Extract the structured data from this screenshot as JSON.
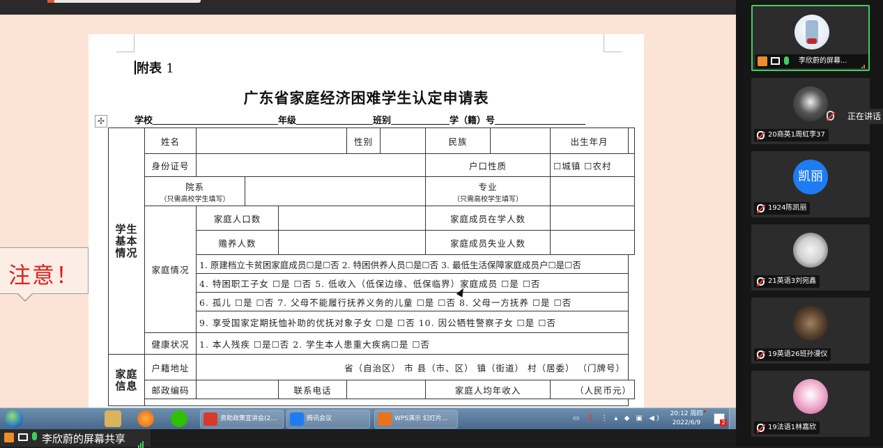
{
  "document": {
    "appendix_label": "附表",
    "appendix_num": "1",
    "title": "广东省家庭经济困难学生认定申请表",
    "header_school": "学校",
    "header_grade": "年级",
    "header_class": "班别",
    "header_id": "学（籍）号",
    "section_basic": "学生基本情况",
    "section_family": "家庭信息",
    "row_name": "姓名",
    "row_gender": "性别",
    "row_ethnicity": "民族",
    "row_birth": "出生年月",
    "row_idcard": "身份证号",
    "row_hukou": "户口性质",
    "hukou_options": "☐城镇    ☐农村",
    "row_faculty": "院系",
    "row_faculty_note": "（只需高校学生填写）",
    "row_major": "专业",
    "row_major_note": "（只需高校学生填写）",
    "row_family_situation": "家庭情况",
    "row_household_size": "家庭人口数",
    "row_studying_members": "家庭成员在学人数",
    "row_dependents": "赡养人数",
    "row_unemployed_members": "家庭成员失业人数",
    "fs_line1": "1. 原建档立卡贫困家庭成员☐是☐否 2. 特困供养人员☐是☐否 3. 最低生活保障家庭成员户☐是☐否",
    "fs_line2": "4. 特困职工子女  ☐是  ☐否     5. 低收入（低保边缘、低保临界）家庭成员  ☐是  ☐否",
    "fs_line3": "6. 孤儿  ☐是  ☐否  7. 父母不能履行抚养义务的儿童  ☐是  ☐否   8. 父母一方抚养  ☐是  ☐否",
    "fs_line4": "9. 享受国家定期抚恤补助的优抚对象子女  ☐是  ☐否     10. 因公牺牲警察子女  ☐是   ☐否",
    "row_health": "健康状况",
    "health_options": "1. 本人残疾  ☐是☐否        2. 学生本人患重大疾病☐是   ☐否",
    "row_address": "户籍地址",
    "address_template": "省（自治区）    市     县（市、区）    镇（街道）    村（居委）            （门牌号）",
    "row_postcode": "邮政编码",
    "row_phone": "联系电话",
    "row_income": "家庭人均年收入",
    "income_unit": "（人民币元）"
  },
  "attention": "注意！",
  "taskbar": {
    "task1": "资助政策宣讲会(2...",
    "task2": "腾讯会议",
    "task3": "WPS演示 幻灯片...",
    "tray_icons": "▭ ❓ ⋮ ▴ ◆ ▣ ◀)",
    "time": "20:12 周四",
    "date": "2022/6/9",
    "flag_badge": "2"
  },
  "share_label": "李欣蔚的屏幕共享",
  "participants": [
    {
      "name": "李欣蔚的屏幕...",
      "avatar": "",
      "active": true
    },
    {
      "name": "20商英1周虹李37",
      "avatar": ""
    },
    {
      "name": "1924陈凯丽",
      "avatar": "凯丽"
    },
    {
      "name": "21英语3刘宛鑫",
      "avatar": ""
    },
    {
      "name": "19英语26班孙漫仪",
      "avatar": ""
    },
    {
      "name": "19法语1林嘉欣",
      "avatar": ""
    }
  ],
  "speaking_label": "正在讲话",
  "colors": {
    "accent_green": "#3fcf5f",
    "attention_red": "#e02020",
    "stage_bg": "#fbe3d6",
    "avatar_blue": "#1d7cf2"
  }
}
